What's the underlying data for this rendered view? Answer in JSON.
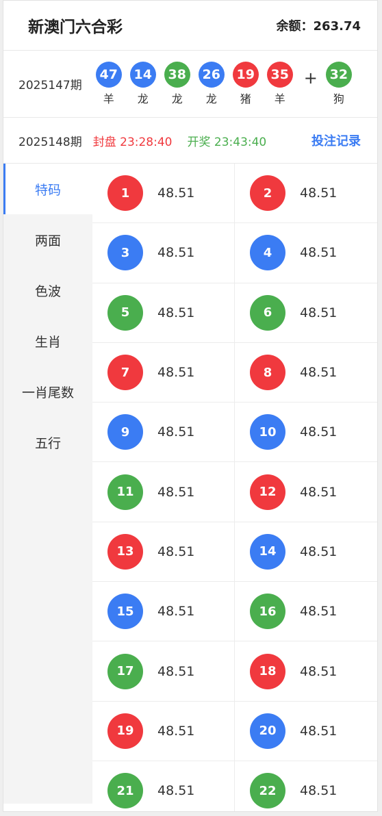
{
  "header": {
    "title": "新澳门六合彩",
    "balance": "余额：263.74"
  },
  "colors": {
    "red": "#f0393e",
    "blue": "#3b7cf3",
    "green": "#4aae4e"
  },
  "last_draw": {
    "period": "2025147期",
    "balls": [
      {
        "num": "47",
        "zodiac": "羊",
        "color": "blue"
      },
      {
        "num": "14",
        "zodiac": "龙",
        "color": "blue"
      },
      {
        "num": "38",
        "zodiac": "龙",
        "color": "green"
      },
      {
        "num": "26",
        "zodiac": "龙",
        "color": "blue"
      },
      {
        "num": "19",
        "zodiac": "猪",
        "color": "red"
      },
      {
        "num": "35",
        "zodiac": "羊",
        "color": "red"
      }
    ],
    "plus": "+",
    "special": {
      "num": "32",
      "zodiac": "狗",
      "color": "green"
    }
  },
  "next_draw": {
    "period": "2025148期",
    "close_time": "封盘 23:28:40",
    "open_time": "开奖 23:43:40",
    "record_label": "投注记录"
  },
  "sidebar": {
    "items": [
      {
        "label": "特码",
        "active": true
      },
      {
        "label": "两面",
        "active": false
      },
      {
        "label": "色波",
        "active": false
      },
      {
        "label": "生肖",
        "active": false
      },
      {
        "label": "一肖尾数",
        "active": false
      },
      {
        "label": "五行",
        "active": false
      }
    ]
  },
  "grid": {
    "items": [
      {
        "num": "1",
        "odds": "48.51",
        "color": "red"
      },
      {
        "num": "2",
        "odds": "48.51",
        "color": "red"
      },
      {
        "num": "3",
        "odds": "48.51",
        "color": "blue"
      },
      {
        "num": "4",
        "odds": "48.51",
        "color": "blue"
      },
      {
        "num": "5",
        "odds": "48.51",
        "color": "green"
      },
      {
        "num": "6",
        "odds": "48.51",
        "color": "green"
      },
      {
        "num": "7",
        "odds": "48.51",
        "color": "red"
      },
      {
        "num": "8",
        "odds": "48.51",
        "color": "red"
      },
      {
        "num": "9",
        "odds": "48.51",
        "color": "blue"
      },
      {
        "num": "10",
        "odds": "48.51",
        "color": "blue"
      },
      {
        "num": "11",
        "odds": "48.51",
        "color": "green"
      },
      {
        "num": "12",
        "odds": "48.51",
        "color": "red"
      },
      {
        "num": "13",
        "odds": "48.51",
        "color": "red"
      },
      {
        "num": "14",
        "odds": "48.51",
        "color": "blue"
      },
      {
        "num": "15",
        "odds": "48.51",
        "color": "blue"
      },
      {
        "num": "16",
        "odds": "48.51",
        "color": "green"
      },
      {
        "num": "17",
        "odds": "48.51",
        "color": "green"
      },
      {
        "num": "18",
        "odds": "48.51",
        "color": "red"
      },
      {
        "num": "19",
        "odds": "48.51",
        "color": "red"
      },
      {
        "num": "20",
        "odds": "48.51",
        "color": "blue"
      },
      {
        "num": "21",
        "odds": "48.51",
        "color": "green"
      },
      {
        "num": "22",
        "odds": "48.51",
        "color": "green"
      }
    ]
  }
}
